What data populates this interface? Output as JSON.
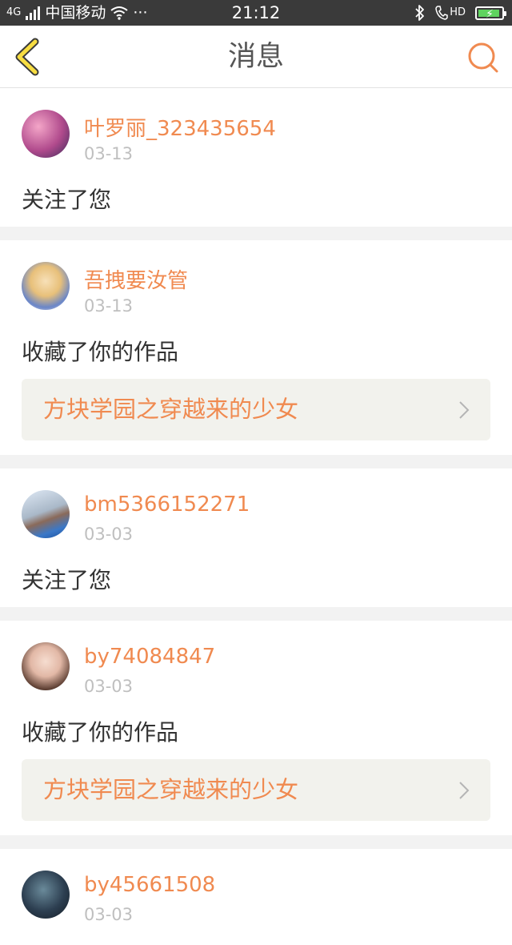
{
  "status_bar": {
    "network_badge": "4G",
    "carrier": "中国移动",
    "dots": "···",
    "time": "21:12",
    "hd": "HD"
  },
  "header": {
    "title": "消息",
    "accent_color": "#f08a50"
  },
  "messages": [
    {
      "username": "叶罗丽_323435654",
      "date": "03-13",
      "action": "关注了您",
      "work": null,
      "avatar": "avatar-1"
    },
    {
      "username": "吾拽要汝管",
      "date": "03-13",
      "action": "收藏了你的作品",
      "work": "方块学园之穿越来的少女",
      "avatar": "avatar-2"
    },
    {
      "username": "bm5366152271",
      "date": "03-03",
      "action": "关注了您",
      "work": null,
      "avatar": "avatar-3"
    },
    {
      "username": "by74084847",
      "date": "03-03",
      "action": "收藏了你的作品",
      "work": "方块学园之穿越来的少女",
      "avatar": "avatar-4"
    },
    {
      "username": "by45661508",
      "date": "03-03",
      "action": "",
      "work": null,
      "avatar": "avatar-5"
    }
  ]
}
